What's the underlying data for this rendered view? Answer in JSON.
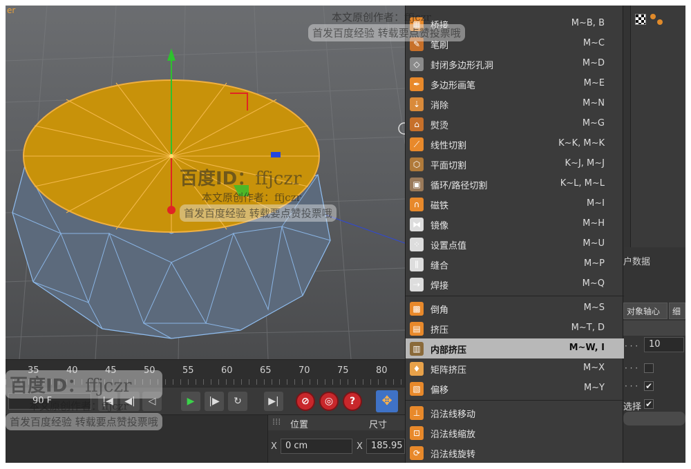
{
  "viewport": {
    "corner_label": "er"
  },
  "timeline": {
    "numbers": [
      "35",
      "40",
      "45",
      "50",
      "55",
      "60",
      "65",
      "70",
      "75",
      "80"
    ]
  },
  "transport": {
    "frame_value": "90 F"
  },
  "coordinates": {
    "position_header": "位置",
    "size_header": "尺寸",
    "x_axis": "X",
    "x_position": "0 cm",
    "x_size": "185.95 c"
  },
  "menu": {
    "items": [
      {
        "label": "桥接",
        "shortcut": "M~B, B",
        "icon": "bridge-icon",
        "color": "#e8892b"
      },
      {
        "label": "笔刷",
        "shortcut": "M~C",
        "icon": "brush-icon",
        "color": "#c7702a"
      },
      {
        "label": "封闭多边形孔洞",
        "shortcut": "M~D",
        "icon": "close-hole-icon",
        "color": "#8a8a8a"
      },
      {
        "label": "多边形画笔",
        "shortcut": "M~E",
        "icon": "polygon-pen-icon",
        "color": "#e8892b"
      },
      {
        "label": "消除",
        "shortcut": "M~N",
        "icon": "dissolve-icon",
        "color": "#d98a3a"
      },
      {
        "label": "熨烫",
        "shortcut": "M~G",
        "icon": "iron-icon",
        "color": "#c7702a"
      },
      {
        "label": "线性切割",
        "shortcut": "K~K, M~K",
        "icon": "line-cut-icon",
        "color": "#e8892b"
      },
      {
        "label": "平面切割",
        "shortcut": "K~J, M~J",
        "icon": "plane-cut-icon",
        "color": "#b07a3a"
      },
      {
        "label": "循环/路径切割",
        "shortcut": "K~L, M~L",
        "icon": "loop-cut-icon",
        "color": "#9a7a5a"
      },
      {
        "label": "磁铁",
        "shortcut": "M~I",
        "icon": "magnet-icon",
        "color": "#e8892b"
      },
      {
        "label": "镜像",
        "shortcut": "M~H",
        "icon": "mirror-icon",
        "color": "#dddddd"
      },
      {
        "label": "设置点值",
        "shortcut": "M~U",
        "icon": "set-point-icon",
        "color": "#dddddd"
      },
      {
        "label": "缝合",
        "shortcut": "M~P",
        "icon": "stitch-icon",
        "color": "#dddddd"
      },
      {
        "label": "焊接",
        "shortcut": "M~Q",
        "icon": "weld-icon",
        "color": "#dddddd"
      },
      {
        "label": "倒角",
        "shortcut": "M~S",
        "icon": "bevel-icon",
        "color": "#e8892b"
      },
      {
        "label": "挤压",
        "shortcut": "M~T, D",
        "icon": "extrude-icon",
        "color": "#e8892b"
      },
      {
        "label": "内部挤压",
        "shortcut": "M~W, I",
        "icon": "extrude-inner-icon",
        "color": "#8a6a3a",
        "highlighted": true
      },
      {
        "label": "矩阵挤压",
        "shortcut": "M~X",
        "icon": "matrix-extrude-icon",
        "color": "#e8a24a"
      },
      {
        "label": "偏移",
        "shortcut": "M~Y",
        "icon": "offset-icon",
        "color": "#e8892b"
      },
      {
        "label": "沿法线移动",
        "shortcut": "",
        "icon": "normal-move-icon",
        "color": "#e8892b"
      },
      {
        "label": "沿法线缩放",
        "shortcut": "",
        "icon": "normal-scale-icon",
        "color": "#e8892b"
      },
      {
        "label": "沿法线旋转",
        "shortcut": "",
        "icon": "normal-rotate-icon",
        "color": "#e8892b"
      }
    ]
  },
  "attributes": {
    "tab_label": "户数据",
    "axis_button": "对象轴心",
    "detail_button": "细",
    "input_value": "10",
    "dots": "· · ·",
    "checkbox_2": "✔",
    "select_label": "选择",
    "checkbox_3": "✔"
  },
  "watermark": {
    "brand": "百度ID：",
    "id": "ffjczr",
    "author_line": "本文原创作者：ffjczr",
    "notice_line": "首发百度经验  转载要点赞投票哦",
    "author_line_top": "本文原创作者：ffjczr",
    "notice_line_top": "首发百度经验  转载要点赞投票哦"
  },
  "colors": {
    "top_face": "#c8920a",
    "edge_orange": "#f0b040",
    "mesh_blue": "#7fb0e6",
    "highlight_bg": "#b8b8b8"
  }
}
